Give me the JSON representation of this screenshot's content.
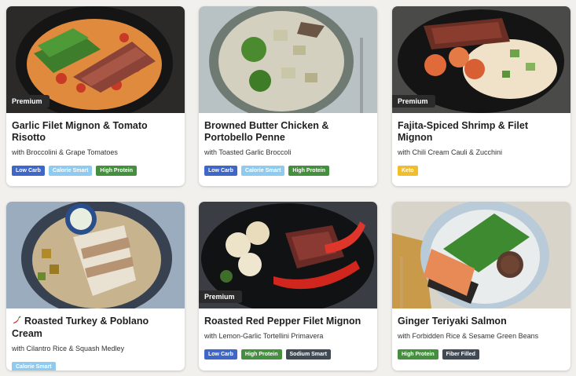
{
  "tag_colors": {
    "Low Carb": "#3f67c8",
    "Calorie Smart": "#8fcbf0",
    "High Protein": "#45903f",
    "Keto": "#f0bd2c",
    "Sodium Smart": "#3f4a54",
    "Fiber Filled": "#3f4a54"
  },
  "meals": [
    {
      "premium": "Premium",
      "title": "Garlic Filet Mignon & Tomato Risotto",
      "subtitle": "with Broccolini & Grape Tomatoes",
      "tags": [
        "Low Carb",
        "Calorie Smart",
        "High Protein"
      ]
    },
    {
      "premium": "",
      "title": "Browned Butter Chicken & Portobello Penne",
      "subtitle": "with Toasted Garlic Broccoli",
      "tags": [
        "Low Carb",
        "Calorie Smart",
        "High Protein"
      ]
    },
    {
      "premium": "Premium",
      "title": "Fajita-Spiced Shrimp & Filet Mignon",
      "subtitle": "with Chili Cream Cauli & Zucchini",
      "tags": [
        "Keto"
      ]
    },
    {
      "premium": "",
      "spicy_icon": "chili-pepper-icon",
      "title": "Roasted Turkey & Poblano Cream",
      "subtitle": "with Cilantro Rice & Squash Medley",
      "tags": [
        "Calorie Smart"
      ]
    },
    {
      "premium": "Premium",
      "title": "Roasted Red Pepper Filet Mignon",
      "subtitle": "with Lemon-Garlic Tortellini Primavera",
      "tags": [
        "Low Carb",
        "High Protein",
        "Sodium Smart"
      ]
    },
    {
      "premium": "",
      "title": "Ginger Teriyaki Salmon",
      "subtitle": "with Forbidden Rice & Sesame Green Beans",
      "tags": [
        "High Protein",
        "Fiber Filled"
      ]
    }
  ]
}
